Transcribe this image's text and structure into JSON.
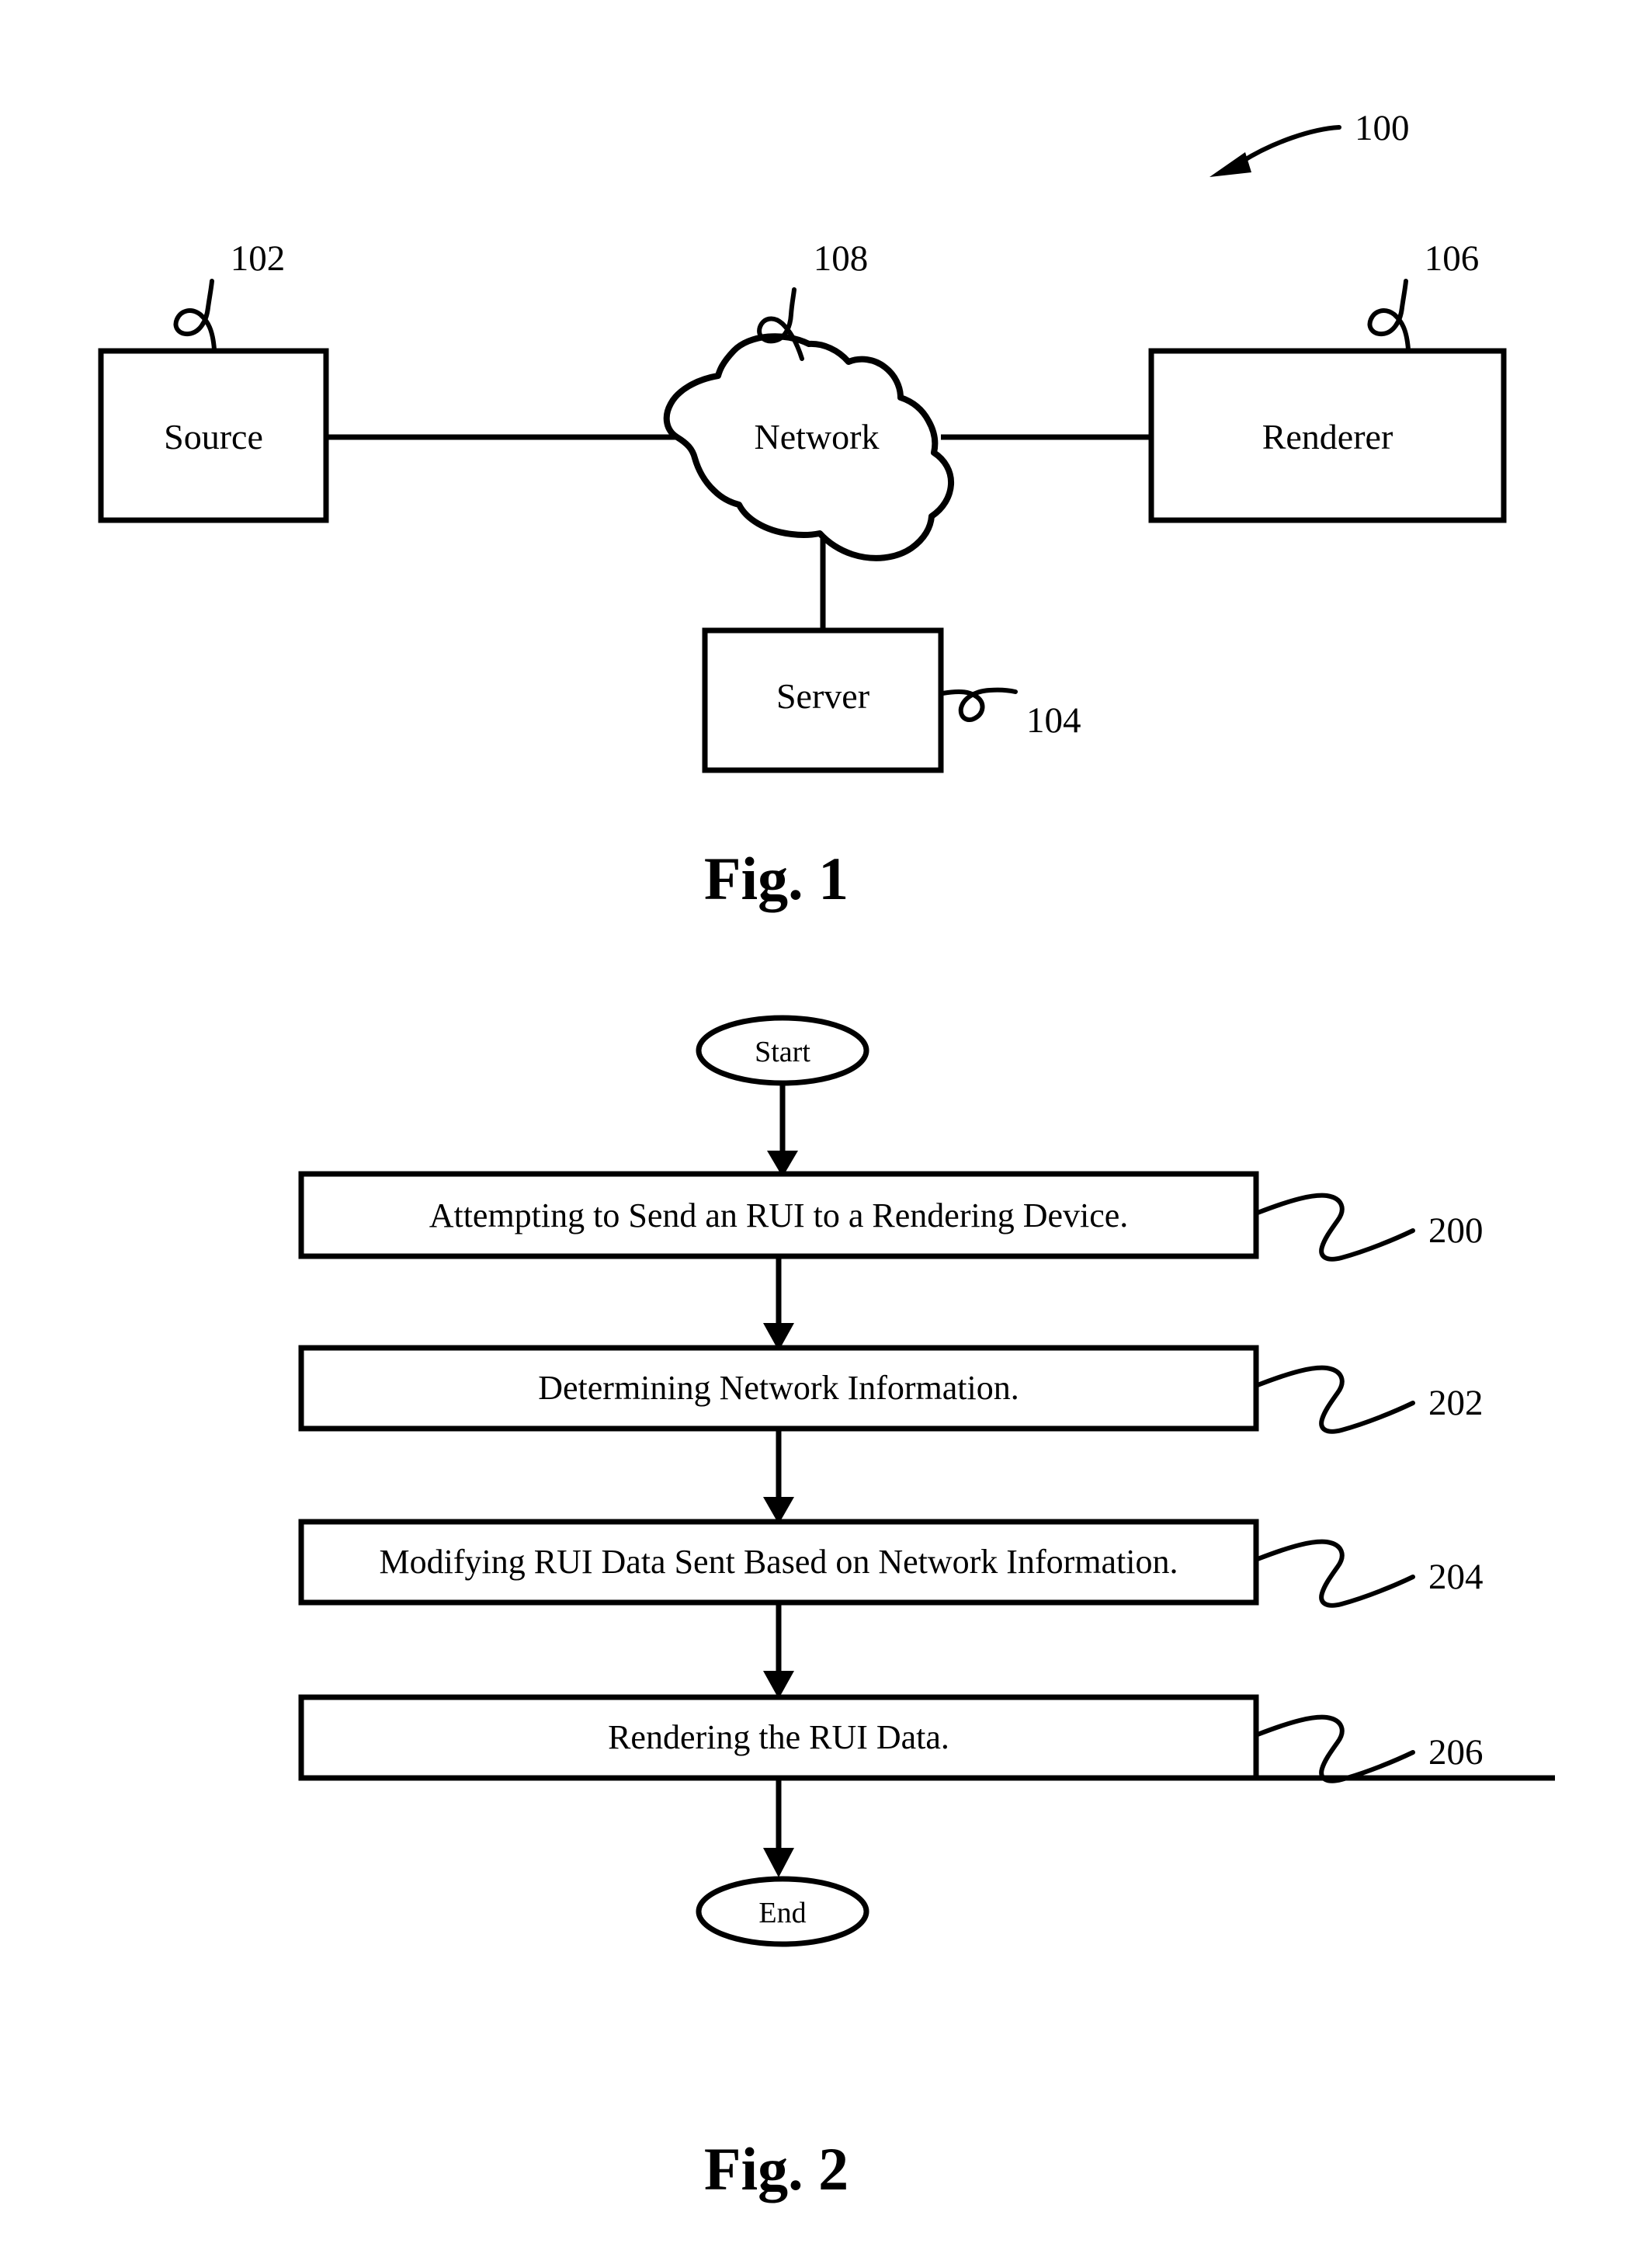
{
  "document": {
    "type": "patent-drawing-sheet",
    "background_color": "#ffffff",
    "line_color": "#000000"
  },
  "figure1": {
    "caption": "Fig. 1",
    "system_ref": "100",
    "nodes": [
      {
        "id": "source",
        "label": "Source",
        "ref": "102",
        "shape": "rectangle"
      },
      {
        "id": "network",
        "label": "Network",
        "ref": "108",
        "shape": "cloud"
      },
      {
        "id": "renderer",
        "label": "Renderer",
        "ref": "106",
        "shape": "rectangle"
      },
      {
        "id": "server",
        "label": "Server",
        "ref": "104",
        "shape": "rectangle"
      }
    ],
    "connections": [
      {
        "from": "source",
        "to": "network"
      },
      {
        "from": "network",
        "to": "renderer"
      },
      {
        "from": "network",
        "to": "server"
      }
    ]
  },
  "figure2": {
    "caption": "Fig. 2",
    "start_label": "Start",
    "end_label": "End",
    "steps": [
      {
        "ref": "200",
        "text": "Attempting to Send an RUI to a Rendering Device."
      },
      {
        "ref": "202",
        "text": "Determining Network Information."
      },
      {
        "ref": "204",
        "text": "Modifying RUI Data Sent Based on Network Information."
      },
      {
        "ref": "206",
        "text": "Rendering the RUI Data."
      }
    ]
  }
}
